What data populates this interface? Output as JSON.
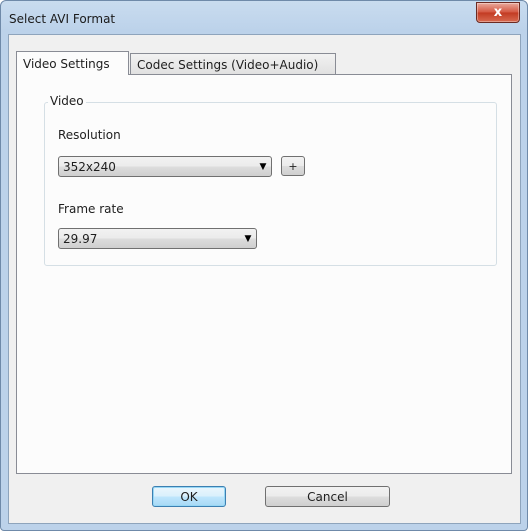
{
  "window": {
    "title": "Select AVI Format",
    "close_glyph": "x"
  },
  "tabs": [
    {
      "label": "Video Settings",
      "active": true
    },
    {
      "label": "Codec Settings (Video+Audio)",
      "active": false
    }
  ],
  "video_group": {
    "title": "Video",
    "resolution": {
      "label": "Resolution",
      "value": "352x240",
      "add_label": "+"
    },
    "frame_rate": {
      "label": "Frame rate",
      "value": "29.97"
    }
  },
  "buttons": {
    "ok": "OK",
    "cancel": "Cancel"
  },
  "icons": {
    "dropdown": "chevron-down-icon",
    "close": "close-icon"
  }
}
